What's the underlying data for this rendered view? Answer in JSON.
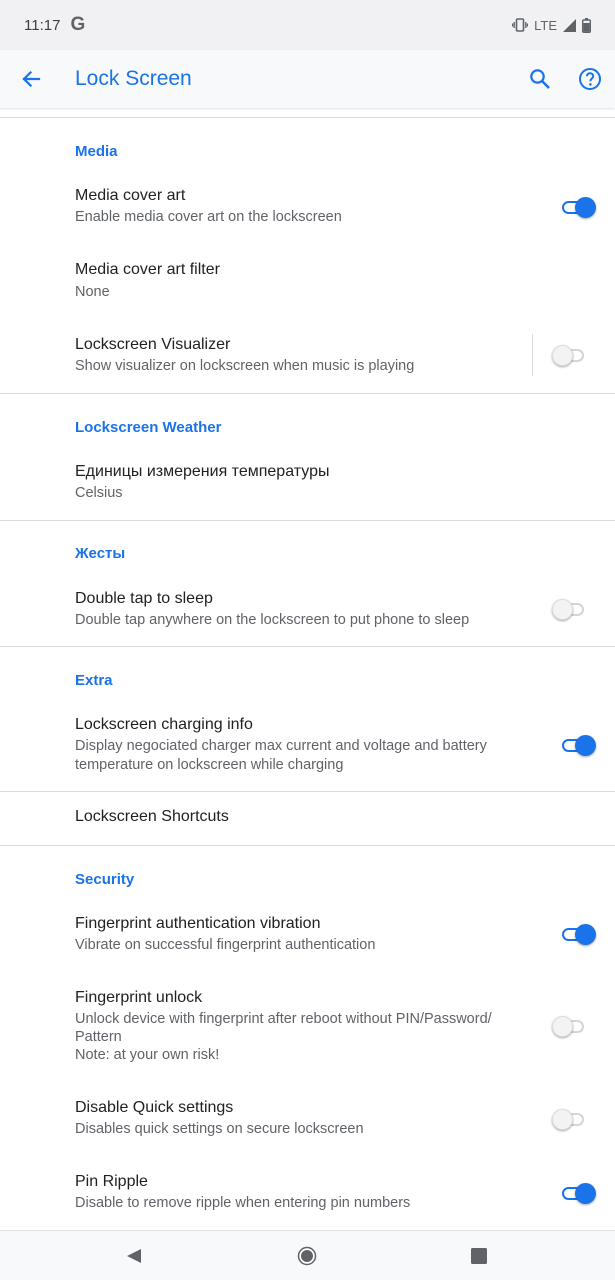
{
  "status_bar": {
    "time": "11:17",
    "google_glyph": "G",
    "network": "LTE",
    "icons": [
      "vibrate-icon",
      "signal-icon",
      "battery-icon"
    ]
  },
  "app_bar": {
    "title": "Lock Screen",
    "icons": [
      "back-arrow-icon",
      "search-icon",
      "help-icon"
    ]
  },
  "colors": {
    "accent": "#1a73e8",
    "primary_text": "#202124",
    "secondary_text": "#5f6368",
    "divider": "#dadce0"
  },
  "sections": {
    "media": {
      "header": "Media",
      "cover_art": {
        "title": "Media cover art",
        "summary": "Enable media cover art on the lockscreen",
        "toggle": "on"
      },
      "cover_art_filter": {
        "title": "Media cover art filter",
        "summary": "None"
      },
      "visualizer": {
        "title": "Lockscreen Visualizer",
        "summary": "Show visualizer on lockscreen when music is playing",
        "toggle": "off"
      }
    },
    "weather": {
      "header": "Lockscreen Weather",
      "temperature_units": {
        "title": "Единицы измерения температуры",
        "summary": "Celsius"
      }
    },
    "gestures": {
      "header": "Жесты",
      "double_tap": {
        "title": "Double tap to sleep",
        "summary": "Double tap anywhere on the lockscreen to put phone to sleep",
        "toggle": "off"
      }
    },
    "extra": {
      "header": "Extra",
      "charging_info": {
        "title": "Lockscreen charging info",
        "summary": "Display negociated charger max current and voltage and battery temperature on lockscreen while charging",
        "toggle": "on"
      },
      "shortcuts": {
        "title": "Lockscreen Shortcuts"
      }
    },
    "security": {
      "header": "Security",
      "fp_vibration": {
        "title": "Fingerprint authentication vibration",
        "summary": "Vibrate on successful fingerprint authentication",
        "toggle": "on"
      },
      "fp_unlock": {
        "title": "Fingerprint unlock",
        "summary_line1": "Unlock device with fingerprint after reboot without PIN/Password/",
        "summary_line2": "Pattern",
        "summary_line3": "Note: at your own risk!",
        "toggle": "off"
      },
      "disable_qs": {
        "title": "Disable Quick settings",
        "summary": "Disables quick settings on secure lockscreen",
        "toggle": "off"
      },
      "pin_ripple": {
        "title": "Pin Ripple",
        "summary": "Disable to remove ripple when entering pin numbers",
        "toggle": "on"
      }
    }
  },
  "nav_bar": {
    "icons": [
      "nav-back-icon",
      "nav-home-icon",
      "nav-recents-icon"
    ]
  }
}
